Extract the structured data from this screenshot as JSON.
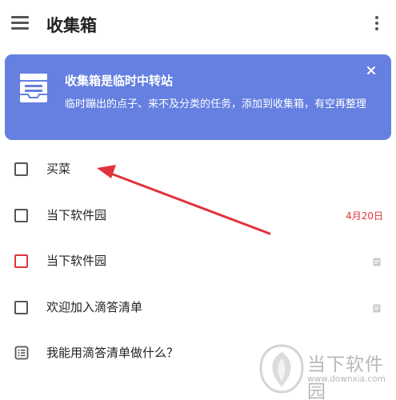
{
  "header": {
    "title": "收集箱",
    "menu_icon": "hamburger-menu-icon",
    "more_icon": "more-vertical-icon"
  },
  "banner": {
    "title": "收集箱是临时中转站",
    "text": "临时蹦出的点子、来不及分类的任务，添加到收集箱，有空再整理",
    "icon": "inbox-tray-icon",
    "close_icon": "close-icon",
    "background_color": "#6580e0"
  },
  "tasks": [
    {
      "label": "买菜",
      "date": "",
      "checkbox_color": "#555555"
    },
    {
      "label": "当下软件园",
      "date": "4月20日",
      "checkbox_color": "#555555"
    },
    {
      "label": "当下软件园",
      "date": "",
      "checkbox_color": "#e0333b",
      "has_note": true
    },
    {
      "label": "欢迎加入滴答清单",
      "date": "",
      "checkbox_color": "#555555",
      "has_note": true
    },
    {
      "label": "我能用滴答清单做什么？",
      "date": "",
      "item_icon": "checklist-doc-icon"
    }
  ],
  "watermark": {
    "brand": "当下软件园",
    "url": "www.downxia.com"
  },
  "annotation_color": "#e0333b",
  "accent_red": "#e0333b"
}
